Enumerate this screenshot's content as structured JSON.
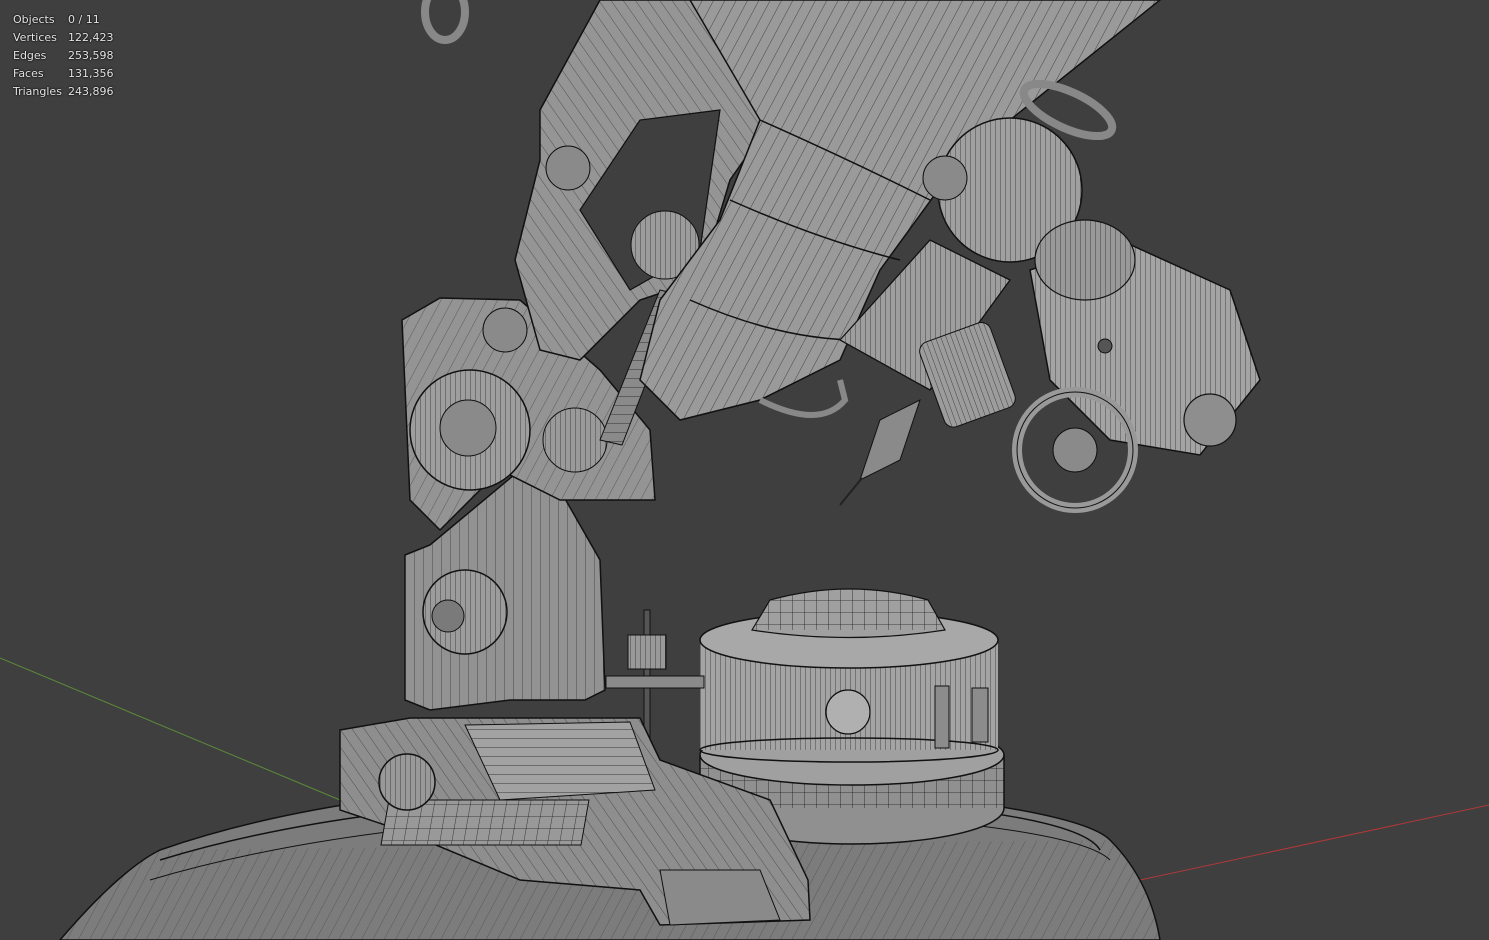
{
  "viewport": {
    "background_color": "#3f3f3f",
    "mesh_fill_color": "#8c8c8c",
    "wire_color": "#1a1a1a",
    "axis_x_color": "#b03838",
    "axis_y_color": "#5a8a3a",
    "shading_mode": "wireframe-overlay"
  },
  "stats": {
    "objects_label": "Objects",
    "objects_value": "0 / 11",
    "vertices_label": "Vertices",
    "vertices_value": "122,423",
    "edges_label": "Edges",
    "edges_value": "253,598",
    "faces_label": "Faces",
    "faces_value": "131,356",
    "triangles_label": "Triangles",
    "triangles_value": "243,896"
  }
}
